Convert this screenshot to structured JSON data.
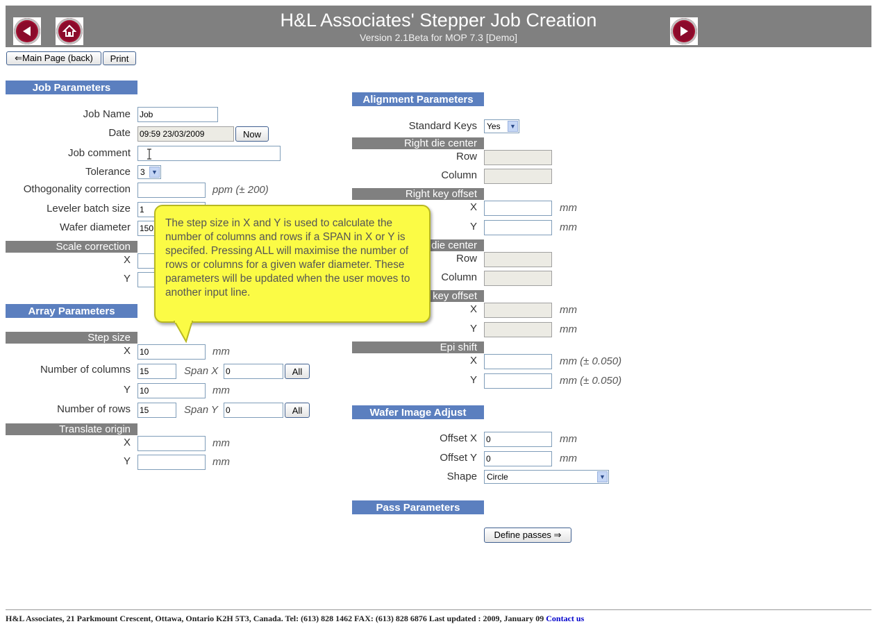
{
  "header": {
    "title": "H&L Associates' Stepper Job Creation",
    "subtitle": "Version 2.1Beta for MOP 7.3   [Demo]"
  },
  "toolbar": {
    "main_page_label": "⇐Main Page (back)",
    "print_label": "Print"
  },
  "job": {
    "section_title": "Job Parameters",
    "job_name_label": "Job Name",
    "job_name_value": "Job",
    "date_label": "Date",
    "date_value": "09:59 23/03/2009",
    "now_label": "Now",
    "comment_label": "Job comment",
    "comment_value": "",
    "tolerance_label": "Tolerance",
    "tolerance_value": "3",
    "ortho_label": "Othogonality correction",
    "ortho_unit": "ppm (± 200)",
    "leveler_label": "Leveler batch size",
    "leveler_value": "1",
    "wafer_label": "Wafer diameter",
    "wafer_value": "150",
    "scale_title": "Scale correction",
    "x_label": "X",
    "y_label": "Y"
  },
  "array": {
    "section_title": "Array Parameters",
    "step_title": "Step size",
    "x_label": "X",
    "y_label": "Y",
    "mm": "mm",
    "step_x": "10",
    "step_y": "10",
    "cols_label": "Number of columns",
    "cols_value": "15",
    "span_x_label": "Span X",
    "span_x_value": "0",
    "rows_label": "Number of rows",
    "rows_value": "15",
    "span_y_label": "Span Y",
    "span_y_value": "0",
    "all_label": "All",
    "translate_title": "Translate origin"
  },
  "align": {
    "section_title": "Alignment Parameters",
    "std_keys_label": "Standard Keys",
    "std_keys_value": "Yes",
    "right_die_title": "Right die center",
    "row_label": "Row",
    "column_label": "Column",
    "right_key_title": "Right key offset",
    "left_die_title": "die center",
    "left_key_title": "key offset",
    "epi_title": "Epi shift",
    "x_label": "X",
    "y_label": "Y",
    "mm": "mm",
    "epi_unit": "mm (± 0.050)"
  },
  "wafer_image": {
    "section_title": "Wafer Image Adjust",
    "offset_x_label": "Offset X",
    "offset_x_value": "0",
    "offset_y_label": "Offset Y",
    "offset_y_value": "0",
    "shape_label": "Shape",
    "shape_value": "Circle",
    "mm": "mm"
  },
  "pass": {
    "section_title": "Pass Parameters",
    "define_label": "Define passes ⇒"
  },
  "callout": {
    "text": "The step size in X and Y is used to calculate the number of columns and rows if a SPAN in X or Y is specifed. Pressing ALL will maximise the number of rows or columns for a given wafer diameter. These parameters will be updated when the user moves to another input line."
  },
  "footer": {
    "text": "H&L Associates, 21 Parkmount Crescent, Ottawa, Ontario K2H 5T3, Canada. Tel: (613) 828 1462   FAX: (613) 828 6876    Last updated : 2009, January 09 ",
    "contact": "Contact us"
  },
  "icons": {
    "back": "left-arrow-icon",
    "home": "home-icon",
    "forward": "right-arrow-icon"
  },
  "colors": {
    "header_bg": "#808080",
    "section_bg": "#5b7fbf",
    "callout_bg": "#fbfb45"
  }
}
